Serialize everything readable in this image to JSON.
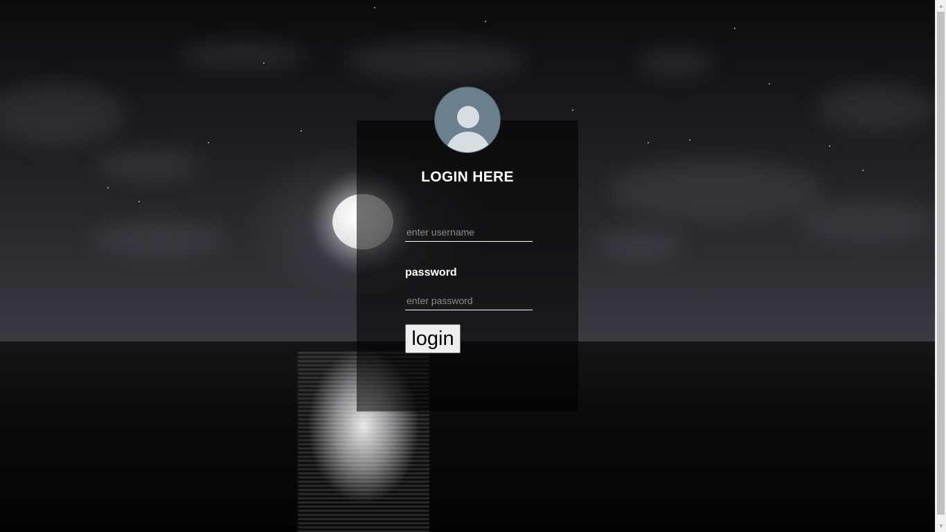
{
  "login": {
    "title": "LOGIN HERE",
    "username_placeholder": "enter username",
    "username_value": "",
    "password_label": "password",
    "password_placeholder": "enter password",
    "password_value": "",
    "button_label": "login"
  },
  "icons": {
    "avatar": "user-avatar-icon",
    "scroll_up": "arrow-up-icon",
    "scroll_down": "arrow-down-icon"
  },
  "colors": {
    "avatar_bg": "#6b7f8c",
    "avatar_fg": "#d7dde2",
    "text": "#ffffff",
    "card_bg": "rgba(0,0,0,0.55)",
    "button_bg": "#efefef"
  }
}
